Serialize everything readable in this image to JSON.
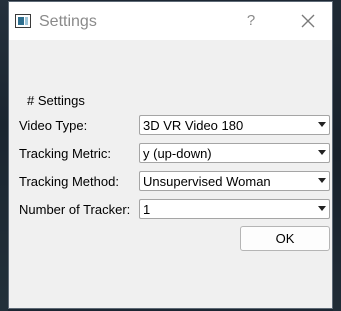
{
  "window": {
    "title": "Settings",
    "help_glyph": "?",
    "icons": {
      "app": "app-window-icon",
      "close": "close-icon",
      "dropdown": "chevron-down-icon"
    }
  },
  "form": {
    "section_title": "# Settings",
    "fields": [
      {
        "label": "Video Type:",
        "value": "3D VR Video 180"
      },
      {
        "label": "Tracking Metric:",
        "value": "y (up-down)"
      },
      {
        "label": "Tracking Method:",
        "value": "Unsupervised Woman"
      },
      {
        "label": "Number of Tracker:",
        "value": "1"
      }
    ]
  },
  "buttons": {
    "ok_label": "OK"
  }
}
